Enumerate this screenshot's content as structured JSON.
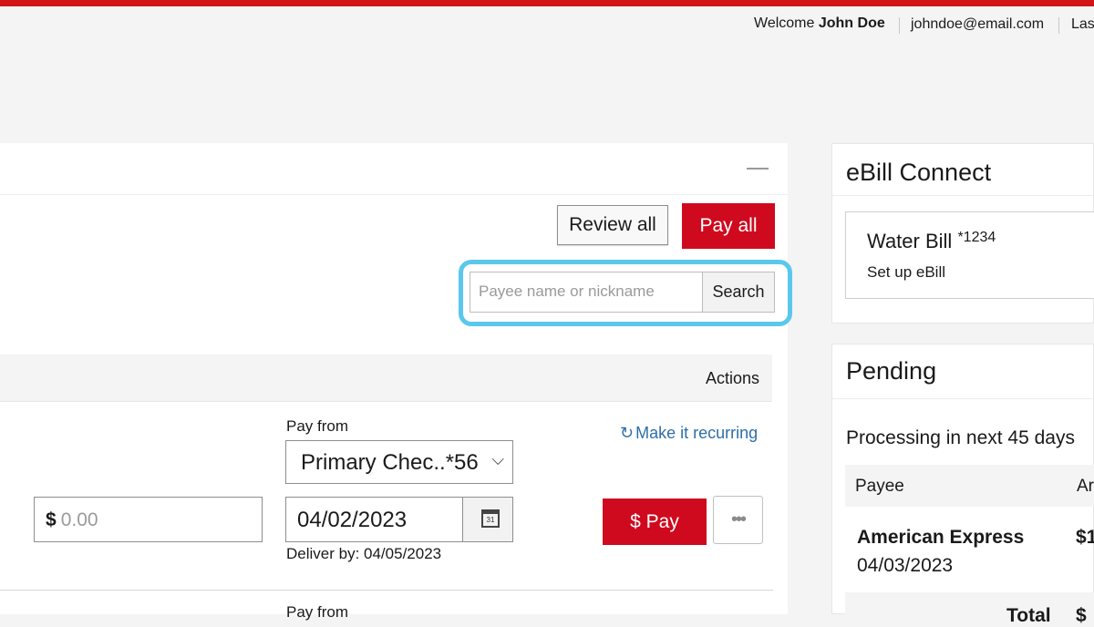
{
  "header": {
    "welcome_prefix": "Welcome",
    "user_name": "John Doe",
    "email": "johndoe@email.com",
    "last_partial": "Las"
  },
  "actions": {
    "review_all": "Review all",
    "pay_all": "Pay all"
  },
  "search": {
    "placeholder": "Payee name or nickname",
    "button": "Search"
  },
  "table": {
    "actions_header": "Actions"
  },
  "payment_row": {
    "pay_from_label": "Pay from",
    "make_recurring": "Make it recurring",
    "account_selected": "Primary Chec..*56",
    "currency_symbol": "$",
    "amount_placeholder": "0.00",
    "date_value": "04/02/2023",
    "calendar_day": "31",
    "deliver_by": "Deliver by: 04/05/2023",
    "pay_button": "$ Pay",
    "more_button": "•••"
  },
  "next_row": {
    "pay_from_label": "Pay from"
  },
  "ebill": {
    "title": "eBill Connect",
    "biller_name": "Water Bill",
    "biller_account": "*1234",
    "setup": "Set up eBill"
  },
  "pending": {
    "title": "Pending",
    "processing": "Processing in next 45 days",
    "col_payee": "Payee",
    "col_amount_partial": "Ar",
    "payment_name": "American Express",
    "payment_amount_partial": "$1",
    "payment_date": "04/03/2023",
    "total_label_partial": "Total",
    "total_amount_partial": "$"
  },
  "colors": {
    "brand_red": "#cf0a1e",
    "topbar_red": "#d2141b",
    "focus_ring": "#5ac8ec",
    "link_blue": "#2e6fa7"
  }
}
